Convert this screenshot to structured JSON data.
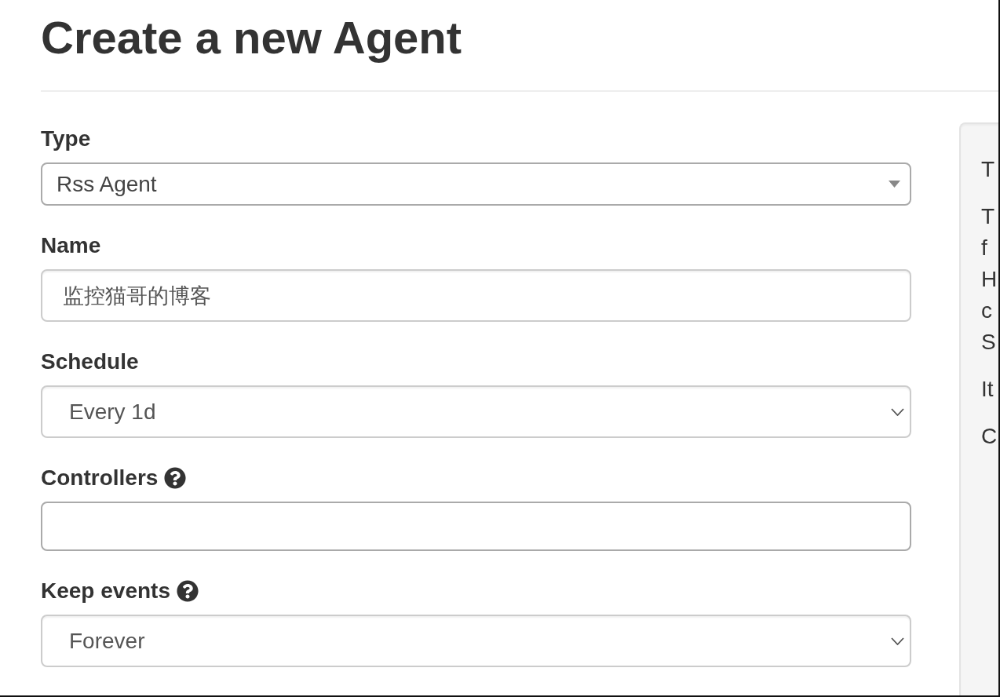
{
  "page": {
    "title": "Create a new Agent"
  },
  "form": {
    "fields": [
      {
        "kind": "combobox",
        "label": "Type",
        "value": "Rss Agent",
        "help": false
      },
      {
        "kind": "text",
        "label": "Name",
        "value": "监控猫哥的博客",
        "help": false
      },
      {
        "kind": "select",
        "label": "Schedule",
        "value": "Every 1d",
        "help": false
      },
      {
        "kind": "multiselect",
        "label": "Controllers",
        "help": true
      },
      {
        "kind": "select",
        "label": "Keep events",
        "value": "Forever",
        "help": true
      }
    ]
  },
  "description_panel": {
    "paragraphs": [
      {
        "lines": [
          "T"
        ]
      },
      {
        "lines": [
          "T",
          "f",
          "H",
          "c",
          "S"
        ]
      },
      {
        "lines": [
          "It"
        ]
      },
      {
        "lines": [
          "C"
        ]
      }
    ]
  }
}
